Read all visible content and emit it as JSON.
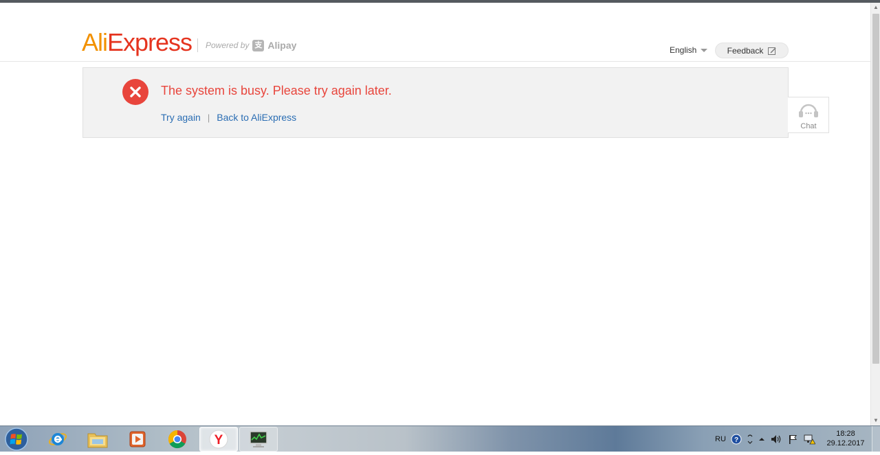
{
  "header": {
    "logo_ali": "Ali",
    "logo_express": "Express",
    "powered_by": "Powered by",
    "alipay": "Alipay",
    "language": "English",
    "feedback_label": "Feedback"
  },
  "message": {
    "title": "The system is busy. Please try again later.",
    "try_again": "Try again",
    "separator": "|",
    "back_link": "Back to AliExpress"
  },
  "chat": {
    "label": "Chat"
  },
  "taskbar": {
    "apps": [
      "windows-start",
      "internet-explorer",
      "file-explorer",
      "media-player",
      "chrome",
      "yandex-browser",
      "system-monitor"
    ],
    "input_language": "RU",
    "time": "18:28",
    "date": "29.12.2017"
  },
  "colors": {
    "brand_orange": "#f29100",
    "brand_red": "#e5341f",
    "error_red": "#e8453c",
    "link_blue": "#2a6db3"
  }
}
